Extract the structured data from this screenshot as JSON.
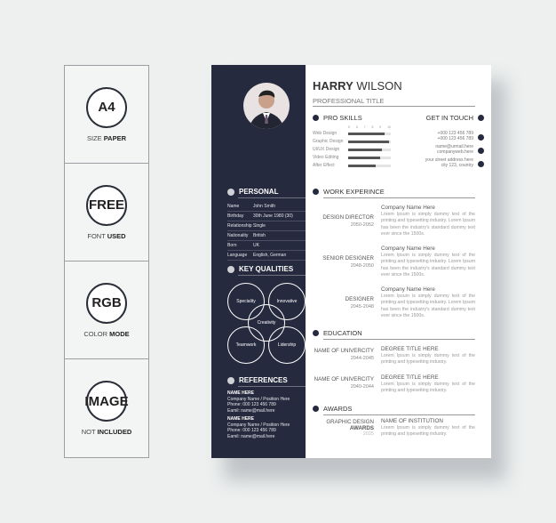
{
  "features": [
    {
      "badge": "A4",
      "label": "SIZE",
      "bold": "PAPER"
    },
    {
      "badge": "FREE",
      "label": "FONT",
      "bold": "USED"
    },
    {
      "badge": "RGB",
      "label": "COLOR",
      "bold": "MODE"
    },
    {
      "badge": "IMAGE",
      "label": "NOT",
      "bold": "INCLUDED"
    }
  ],
  "resume": {
    "first_name": "HARRY",
    "last_name": "WILSON",
    "title": "PROFESSIONAL TITLE",
    "personal": {
      "heading": "PERSONAL",
      "rows": [
        {
          "k": "Name",
          "v": "John Smith"
        },
        {
          "k": "Birthday",
          "v": "30th June 1980 (30)"
        },
        {
          "k": "Relationship",
          "v": "Single"
        },
        {
          "k": "Nationality",
          "v": "British"
        },
        {
          "k": "Born",
          "v": "UK"
        },
        {
          "k": "Language",
          "v": "English, German"
        }
      ]
    },
    "qualities": {
      "heading": "KEY QUALITIES",
      "items": [
        "Speciality",
        "Innovative",
        "Creativity",
        "Teamwork",
        "Lidership"
      ]
    },
    "references": {
      "heading": "REFERENCES",
      "items": [
        {
          "name": "NAME HERE",
          "company": "Company Name / Position Here",
          "phone": "Phone: 000 123 456 789",
          "email": "Eamil: name@mail.here"
        },
        {
          "name": "NAME HERE",
          "company": "Company Name / Position Here",
          "phone": "Phone: 000 123 456 789",
          "email": "Eamil: name@mail.here"
        }
      ]
    },
    "skills": {
      "heading": "PRO SKILLS",
      "scale": [
        "5",
        "6",
        "7",
        "8",
        "9",
        "10"
      ],
      "items": [
        {
          "name": "Web Design",
          "level": 0.85
        },
        {
          "name": "Graphic Design",
          "level": 0.95
        },
        {
          "name": "UI/UX Design",
          "level": 0.8
        },
        {
          "name": "Video Editing",
          "level": 0.75
        },
        {
          "name": "After Effect",
          "level": 0.65
        }
      ]
    },
    "contact": {
      "heading": "GET IN TOUCH",
      "phone1": "+000 123 456 789",
      "phone2": "+000 123 456 789",
      "email": "name@urmail.here",
      "web": "companyweb.here",
      "address1": "your street address here",
      "address2": "city 123, country"
    },
    "work": {
      "heading": "WORK EXPERINCE",
      "items": [
        {
          "position": "DESIGN DIRECTOR",
          "years": "2050-2052",
          "company": "Company Name Here",
          "desc": "Lorem Ipsum is simply dummy text of the printing and typesetting industry. Lorem Ipsum has been the industry's standard dummy text ever since the 1500s."
        },
        {
          "position": "SENIOR DESIGNER",
          "years": "2048-2050",
          "company": "Company Name Here",
          "desc": "Lorem Ipsum is simply dummy text of the printing and typesetting industry. Lorem Ipsum has been the industry's standard dummy text ever since the 1500s."
        },
        {
          "position": "DESIGNER",
          "years": "2045-2048",
          "company": "Company Name Here",
          "desc": "Lorem Ipsum is simply dummy text of the printing and typesetting industry. Lorem Ipsum has been the industry's standard dummy text ever since the 1500s."
        }
      ]
    },
    "education": {
      "heading": "EDUCATION",
      "items": [
        {
          "school": "NAME OF UNIVERCITY",
          "years": "2044-2045",
          "degree": "DEGREE TITLE HERE",
          "desc": "Lorem Ipsum is simply dummy text of the printing and typesetting industry."
        },
        {
          "school": "NAME OF UNIVERCITY",
          "years": "2040-2044",
          "degree": "DEGREE TITLE HERE",
          "desc": "Lorem Ipsum is simply dummy text of the printing and typesetting industry."
        }
      ]
    },
    "awards": {
      "heading": "AWARDS",
      "items": [
        {
          "line1": "GRAPHIC DESIGN",
          "line2": "AWARDS",
          "year": "2025",
          "institution": "NAME OF INSTITUTION",
          "desc": "Lorem Ipsum is simply dummy text of the printing and typesetting industry."
        }
      ]
    }
  }
}
